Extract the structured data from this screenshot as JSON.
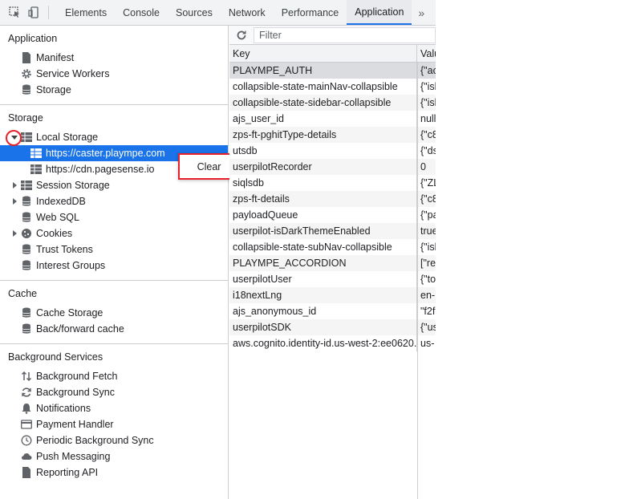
{
  "toolbar": {
    "tabs": [
      {
        "label": "Elements"
      },
      {
        "label": "Console"
      },
      {
        "label": "Sources"
      },
      {
        "label": "Network"
      },
      {
        "label": "Performance"
      },
      {
        "label": "Application"
      }
    ],
    "more": "»"
  },
  "sidebar": {
    "application": {
      "title": "Application",
      "items": [
        {
          "label": "Manifest",
          "icon": "document-icon"
        },
        {
          "label": "Service Workers",
          "icon": "gear-icon"
        },
        {
          "label": "Storage",
          "icon": "database-icon"
        }
      ]
    },
    "storage": {
      "title": "Storage",
      "local_storage": "Local Storage",
      "local_children": [
        {
          "label": "https://caster.plaympe.com"
        },
        {
          "label": "https://cdn.pagesense.io"
        }
      ],
      "session_storage": "Session Storage",
      "indexeddb": "IndexedDB",
      "websql": "Web SQL",
      "cookies": "Cookies",
      "trust_tokens": "Trust Tokens",
      "interest_groups": "Interest Groups"
    },
    "cache": {
      "title": "Cache",
      "items": [
        {
          "label": "Cache Storage"
        },
        {
          "label": "Back/forward cache"
        }
      ]
    },
    "background": {
      "title": "Background Services",
      "items": [
        {
          "label": "Background Fetch",
          "icon": "fetch-arrows-icon"
        },
        {
          "label": "Background Sync",
          "icon": "sync-icon"
        },
        {
          "label": "Notifications",
          "icon": "bell-icon"
        },
        {
          "label": "Payment Handler",
          "icon": "card-icon"
        },
        {
          "label": "Periodic Background Sync",
          "icon": "clock-icon"
        },
        {
          "label": "Push Messaging",
          "icon": "cloud-icon"
        },
        {
          "label": "Reporting API",
          "icon": "document-icon"
        }
      ]
    }
  },
  "context_menu": {
    "clear": "Clear"
  },
  "filter": {
    "placeholder": "Filter"
  },
  "table": {
    "columns": {
      "key": "Key",
      "value": "Valu"
    },
    "rows": [
      {
        "key": "PLAYMPE_AUTH",
        "value": "{\"ac"
      },
      {
        "key": "collapsible-state-mainNav-collapsible",
        "value": "{\"isl"
      },
      {
        "key": "collapsible-state-sidebar-collapsible",
        "value": "{\"isl"
      },
      {
        "key": "ajs_user_id",
        "value": "null"
      },
      {
        "key": "zps-ft-pghitType-details",
        "value": "{\"c8"
      },
      {
        "key": "utsdb",
        "value": "{\"ds"
      },
      {
        "key": "userpilotRecorder",
        "value": "0"
      },
      {
        "key": "siqlsdb",
        "value": "{\"ZL"
      },
      {
        "key": "zps-ft-details",
        "value": "{\"c8"
      },
      {
        "key": "payloadQueue",
        "value": "{\"pa"
      },
      {
        "key": "userpilot-isDarkThemeEnabled",
        "value": "true"
      },
      {
        "key": "collapsible-state-subNav-collapsible",
        "value": "{\"isl"
      },
      {
        "key": "PLAYMPE_ACCORDION",
        "value": "[\"re"
      },
      {
        "key": "userpilotUser",
        "value": "{\"to"
      },
      {
        "key": "i18nextLng",
        "value": "en-"
      },
      {
        "key": "ajs_anonymous_id",
        "value": "\"f2f"
      },
      {
        "key": "userpilotSDK",
        "value": "{\"us"
      },
      {
        "key": "aws.cognito.identity-id.us-west-2:ee0620...",
        "value": "us-"
      }
    ]
  }
}
